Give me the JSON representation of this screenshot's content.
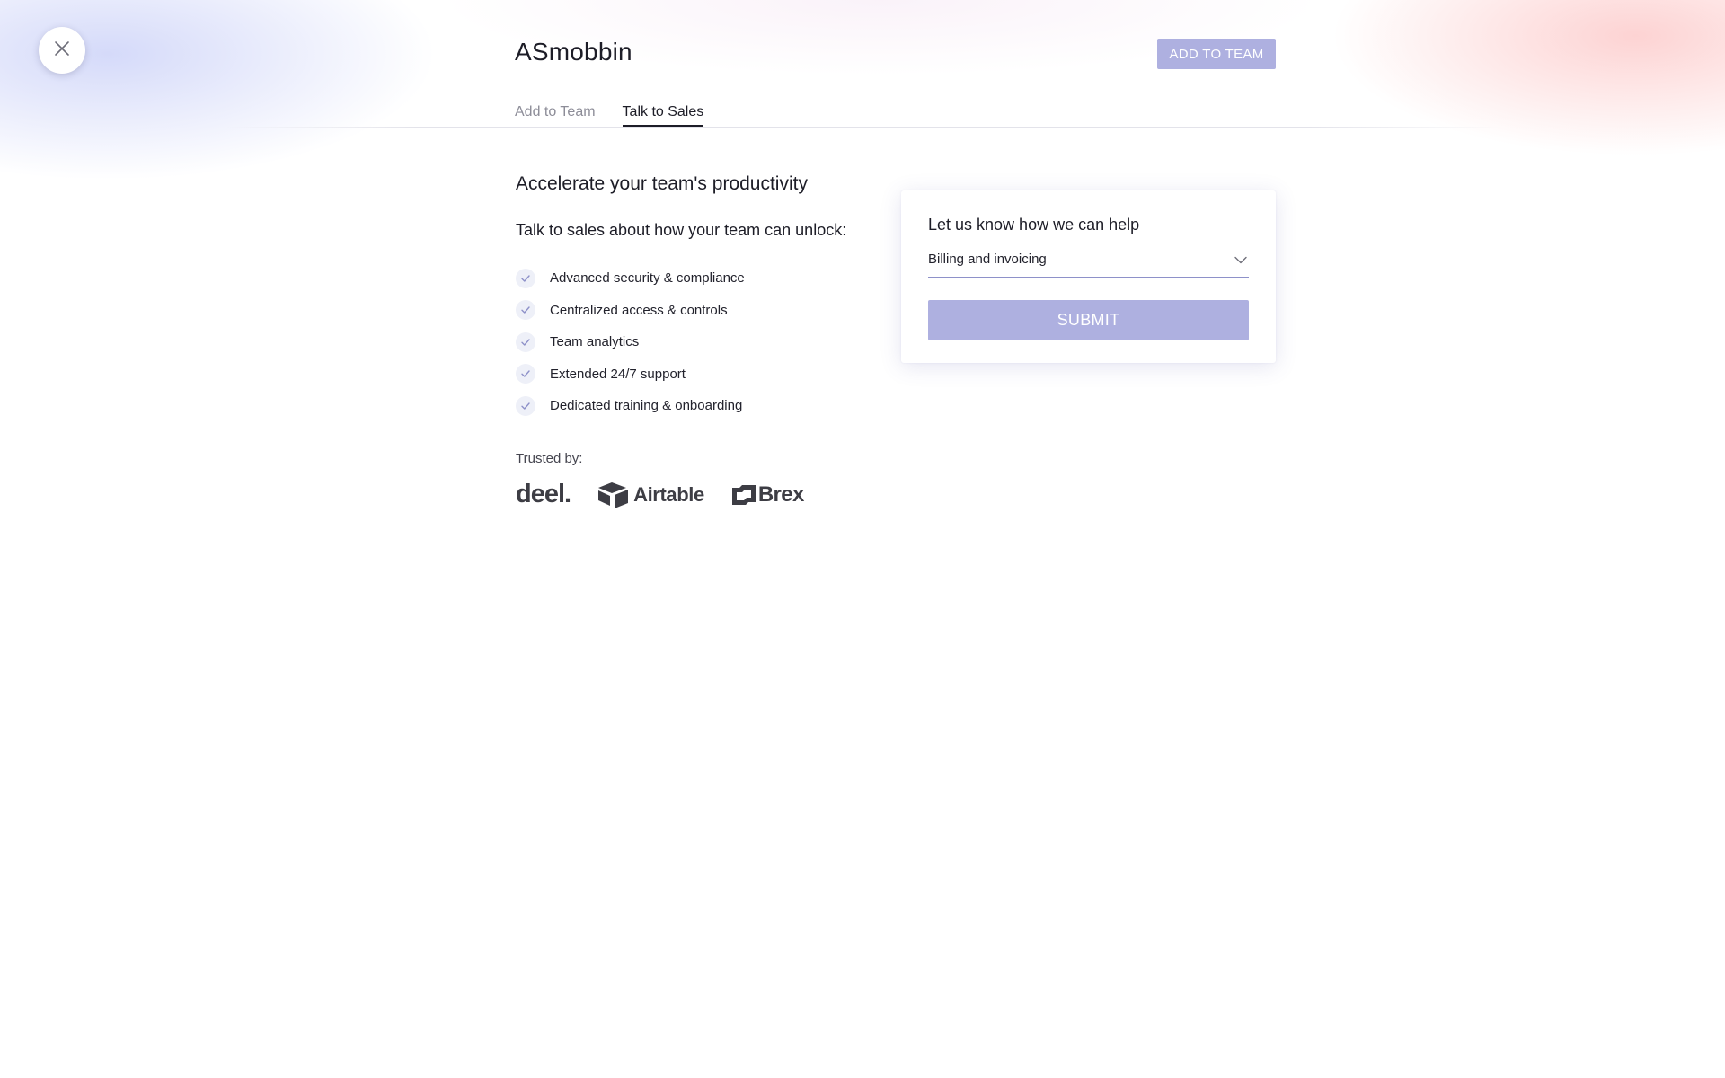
{
  "header": {
    "title": "ASmobbin",
    "add_to_team_label": "ADD TO TEAM"
  },
  "tabs": [
    {
      "label": "Add to Team",
      "active": false
    },
    {
      "label": "Talk to Sales",
      "active": true
    }
  ],
  "main": {
    "headline": "Accelerate your team's productivity",
    "subhead": "Talk to sales about how your team can unlock:",
    "features": [
      "Advanced security & compliance",
      "Centralized access & controls",
      "Team analytics",
      "Extended 24/7 support",
      "Dedicated training & onboarding"
    ],
    "trusted_label": "Trusted by:",
    "logos": [
      "deel.",
      "Airtable",
      "Brex"
    ]
  },
  "form": {
    "title": "Let us know how we can help",
    "select_value": "Billing and invoicing",
    "submit_label": "SUBMIT"
  },
  "icons": {
    "close": "close-icon",
    "check": "check-icon",
    "chevron": "chevron-down-icon"
  },
  "colors": {
    "accent_button": "#aeb0e0",
    "select_underline": "#8e91c9",
    "text_primary": "#1d1d27",
    "text_muted": "#8d8d98",
    "check_bg": "#eef0f8",
    "check_mark": "#8e91c9"
  }
}
